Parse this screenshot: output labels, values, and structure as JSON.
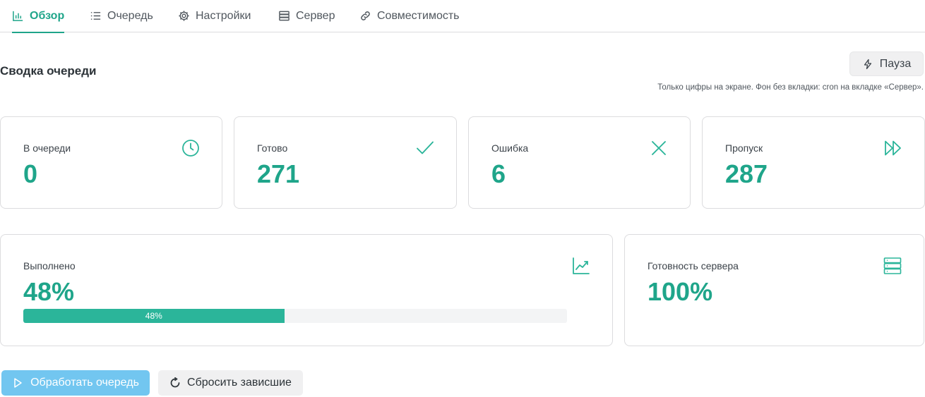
{
  "tabs": [
    {
      "label": "Обзор",
      "icon": "bar-chart-icon",
      "active": true
    },
    {
      "label": "Очередь",
      "icon": "list-icon",
      "active": false
    },
    {
      "label": "Настройки",
      "icon": "gear-icon",
      "active": false
    },
    {
      "label": "Сервер",
      "icon": "server-icon",
      "active": false
    },
    {
      "label": "Совместимость",
      "icon": "link-icon",
      "active": false
    }
  ],
  "summary": {
    "title": "Сводка очереди",
    "pause_label": "Пауза",
    "hint": "Только цифры на экране. Фон без вкладки: cron на вкладке «Сервер»."
  },
  "stats": [
    {
      "label": "В очереди",
      "value": "0",
      "icon": "clock-icon"
    },
    {
      "label": "Готово",
      "value": "271",
      "icon": "check-icon"
    },
    {
      "label": "Ошибка",
      "value": "6",
      "icon": "x-icon"
    },
    {
      "label": "Пропуск",
      "value": "287",
      "icon": "fast-forward-icon"
    }
  ],
  "progress": {
    "label": "Выполнено",
    "value": "48%",
    "bar_text": "48%",
    "fraction": 0.48,
    "icon": "trend-chart-icon"
  },
  "server": {
    "label": "Готовность сервера",
    "value": "100%",
    "icon": "server-icon"
  },
  "actions": {
    "process_label": "Обработать очередь",
    "reset_label": "Сбросить зависшие"
  },
  "colors": {
    "accent": "#1fa58a",
    "progress": "#2bb59a",
    "primary_button": "#72c6f0"
  }
}
